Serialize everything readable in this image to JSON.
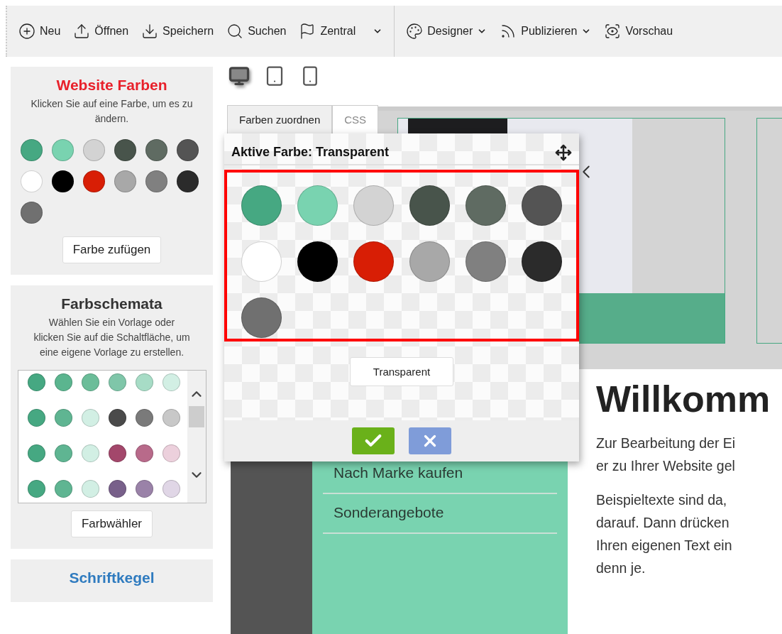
{
  "toolbar": {
    "items": [
      {
        "label": "Neu",
        "dropdown": false
      },
      {
        "label": "Öffnen",
        "dropdown": false
      },
      {
        "label": "Speichern",
        "dropdown": false
      },
      {
        "label": "Suchen",
        "dropdown": false
      },
      {
        "label": "Zentral",
        "dropdown": true
      },
      {
        "label": "Designer",
        "dropdown": true
      },
      {
        "label": "Publizieren",
        "dropdown": true
      },
      {
        "label": "Vorschau",
        "dropdown": false
      }
    ]
  },
  "website_colors": {
    "title": "Website Farben",
    "hint": "Klicken Sie auf eine Farbe, um es zu ändern.",
    "swatches": [
      {
        "color": "#46a882"
      },
      {
        "color": "#79d3b0"
      },
      {
        "color": "#d3d3d3"
      },
      {
        "color": "#48544b"
      },
      {
        "color": "#5f6b62"
      },
      {
        "color": "#545454"
      },
      {
        "color": "#ffffff"
      },
      {
        "color": "#000000"
      },
      {
        "color": "#d81e05"
      },
      {
        "color": "#a8a8a8"
      },
      {
        "color": "#808080"
      },
      {
        "color": "#2b2b2b"
      },
      {
        "color": "#707070"
      }
    ],
    "button": "Farbe zufügen"
  },
  "color_schemes": {
    "title": "Farbschemata",
    "hint": "Wählen Sie ein Vorlage oder klicken Sie auf die Schaltfläche, um eine eigene Vorlage zu erstellen.",
    "schemes": [
      {
        "swatches": [
          {
            "color": "#46a882"
          },
          {
            "color": "#5bb58f"
          },
          {
            "color": "#6bbd99"
          },
          {
            "color": "#7fc6a9"
          },
          {
            "color": "#a7dcc6"
          },
          {
            "color": "#d2efe4"
          }
        ]
      },
      {
        "swatches": [
          {
            "color": "#46a882"
          },
          {
            "color": "#5fb592"
          },
          {
            "color": "#d2efe4"
          },
          {
            "color": "#4a4a4a"
          },
          {
            "color": "#7a7a7a"
          },
          {
            "color": "#c8c8c8"
          }
        ]
      },
      {
        "swatches": [
          {
            "color": "#46a882"
          },
          {
            "color": "#5fb592"
          },
          {
            "color": "#d2efe4"
          },
          {
            "color": "#a3476b"
          },
          {
            "color": "#b86a8a"
          },
          {
            "color": "#ecd0dc"
          }
        ]
      },
      {
        "swatches": [
          {
            "color": "#46a882"
          },
          {
            "color": "#5fb592"
          },
          {
            "color": "#d2efe4"
          },
          {
            "color": "#78608a"
          },
          {
            "color": "#9a82a8"
          },
          {
            "color": "#e0d6e6"
          }
        ]
      }
    ],
    "button": "Farbwähler"
  },
  "font_panel": {
    "title": "Schriftkegel"
  },
  "devices": [
    {
      "selected": true
    },
    {
      "selected": false
    },
    {
      "selected": false
    }
  ],
  "tabs": [
    {
      "label": "Farben zuordnen",
      "selected": true
    },
    {
      "label": "CSS",
      "selected": false
    }
  ],
  "color_popup": {
    "title": "Aktive Farbe: Transparent",
    "swatches": [
      {
        "color": "#46a882"
      },
      {
        "color": "#79d3b0"
      },
      {
        "color": "#d3d3d3"
      },
      {
        "color": "#48544b"
      },
      {
        "color": "#5f6b62"
      },
      {
        "color": "#545454"
      },
      {
        "color": "#ffffff"
      },
      {
        "color": "#000000"
      },
      {
        "color": "#d81e05"
      },
      {
        "color": "#a8a8a8"
      },
      {
        "color": "#808080"
      },
      {
        "color": "#2b2b2b"
      },
      {
        "color": "#707070"
      }
    ],
    "transparent_button": "Transparent"
  },
  "preview": {
    "menu_items": [
      "Nach Marke kaufen",
      "Sonderangebote"
    ],
    "heading": "Willkomm",
    "paragraphs": [
      [
        "Zur Bearbeitung der Ei",
        "er zu Ihrer Website gel"
      ],
      [
        "Beispieltexte sind da,",
        "darauf. Dann drücken",
        "Ihren eigenen Text ein",
        "denn je."
      ]
    ]
  }
}
